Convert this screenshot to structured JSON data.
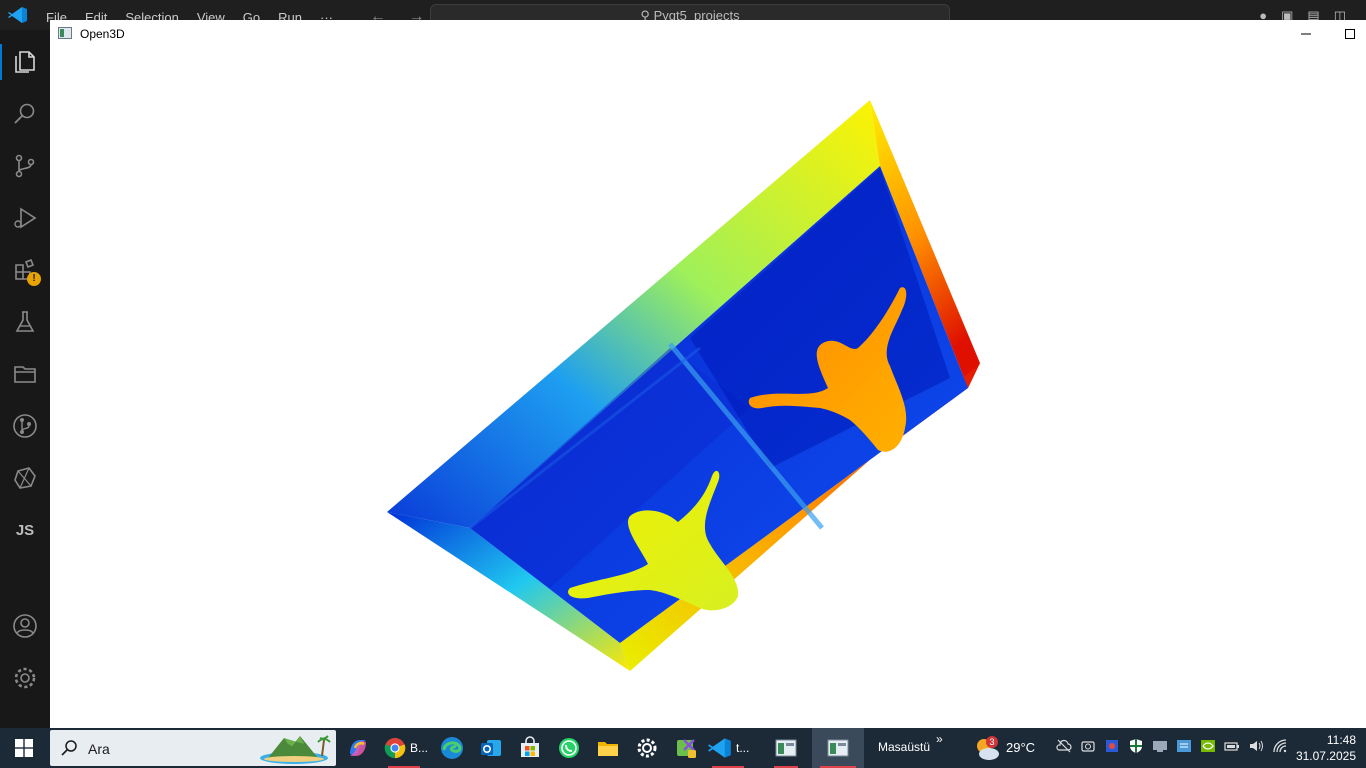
{
  "vscode": {
    "menu": [
      "File",
      "Edit",
      "Selection",
      "View",
      "Go",
      "Run",
      "···"
    ],
    "search_text": "Pyqt5_projects",
    "activity_js_label": "JS"
  },
  "open3d": {
    "title": "Open3D",
    "colormap": "jet"
  },
  "taskbar": {
    "search_placeholder": "Ara",
    "chrome_label": "B...",
    "vscode_label": "t...",
    "news_label": "Masaüstü",
    "news_chevron": "»",
    "weather_badge": "3",
    "temperature": "29°C",
    "time": "11:48",
    "date": "31.07.2025"
  },
  "colors": {
    "vscode_accent": "#0078d4",
    "warning": "#e8a300",
    "taskbar_bg": "#1c2a38"
  }
}
